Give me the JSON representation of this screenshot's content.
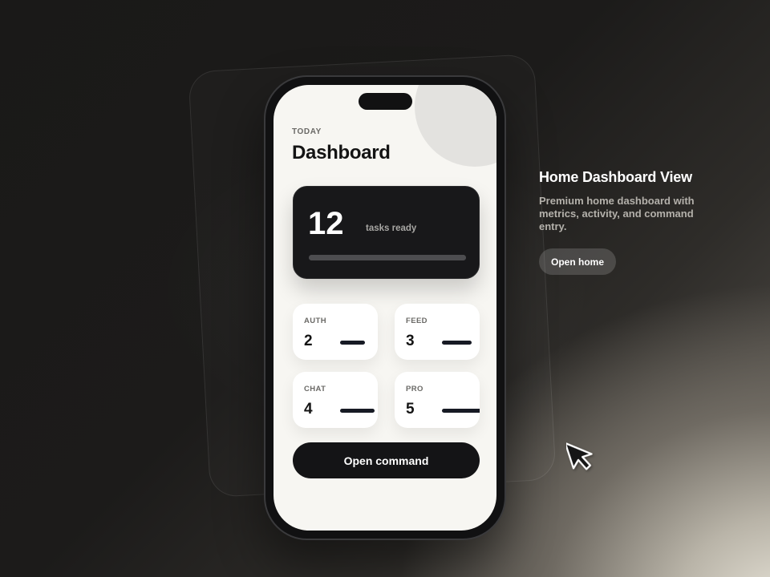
{
  "phone": {
    "eyebrow": "TODAY",
    "title": "Dashboard",
    "hero": {
      "value": "12",
      "caption": "tasks ready",
      "progress": 1.0
    },
    "tiles": [
      {
        "label": "AUTH",
        "value": "2"
      },
      {
        "label": "FEED",
        "value": "3"
      },
      {
        "label": "CHAT",
        "value": "4"
      },
      {
        "label": "PRO",
        "value": "5"
      }
    ],
    "command_button": "Open command"
  },
  "info": {
    "title": "Home Dashboard View",
    "description": "Premium home dashboard with metrics, activity, and command entry.",
    "button": "Open home"
  },
  "icons": {
    "cursor": "mouse-pointer-icon"
  },
  "colors": {
    "accent_dark": "#141416",
    "screen_bg": "#f7f6f2",
    "tile_bar": "#171a24"
  }
}
